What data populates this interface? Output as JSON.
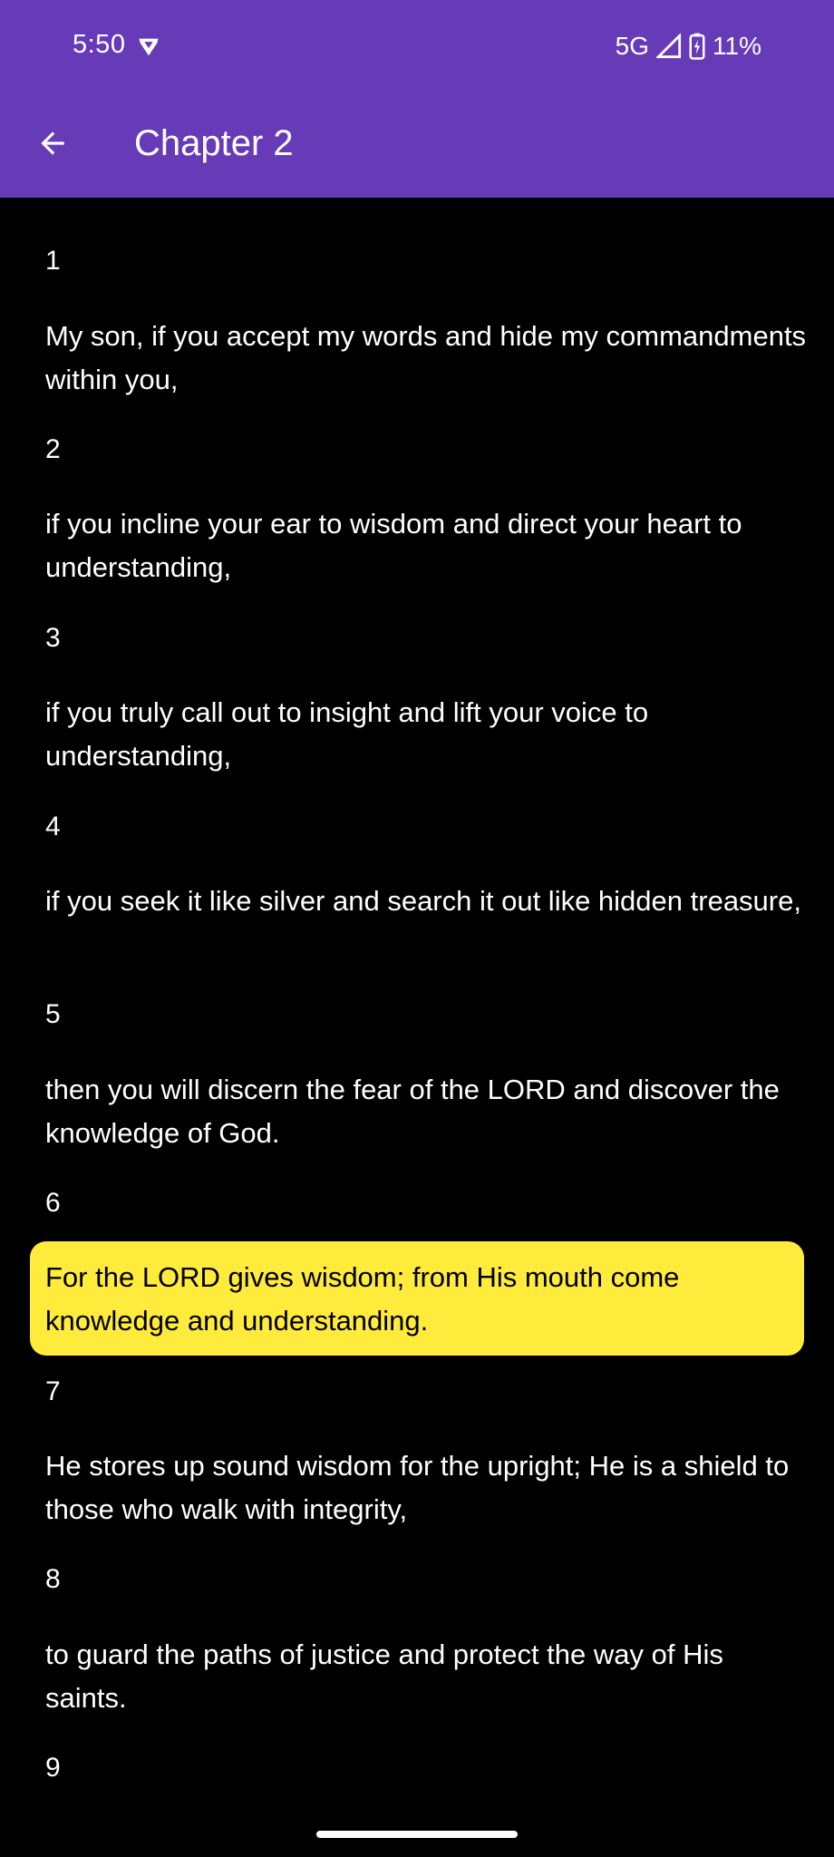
{
  "status_bar": {
    "time": "5:50",
    "network": "5G",
    "battery": "11%"
  },
  "app_bar": {
    "title": "Chapter 2",
    "back_icon": "arrow-back-icon"
  },
  "colors": {
    "header": "#673ab7",
    "background": "#000000",
    "highlight": "#ffeb3b",
    "text": "#ffffff"
  },
  "verses": [
    {
      "number": "1",
      "text": "My son, if you accept my words and hide my commandments within you,"
    },
    {
      "number": "2",
      "text": "if you incline your ear to wisdom and direct your heart to understanding,"
    },
    {
      "number": "3",
      "text": "if you truly call out to insight and lift your voice to understanding,"
    },
    {
      "number": "4",
      "text": "if you seek it like silver and search it out like hidden treasure,"
    },
    {
      "number": "5",
      "text": "then you will discern the fear of the LORD and discover the knowledge of God."
    },
    {
      "number": "6",
      "text": "For the LORD gives wisdom; from His mouth come knowledge and understanding.",
      "highlighted": true
    },
    {
      "number": "7",
      "text": "He stores up sound wisdom for the upright; He is a shield to those who walk with integrity,"
    },
    {
      "number": "8",
      "text": "to guard the paths of justice and protect the way of His saints."
    },
    {
      "number": "9",
      "text": ""
    }
  ]
}
